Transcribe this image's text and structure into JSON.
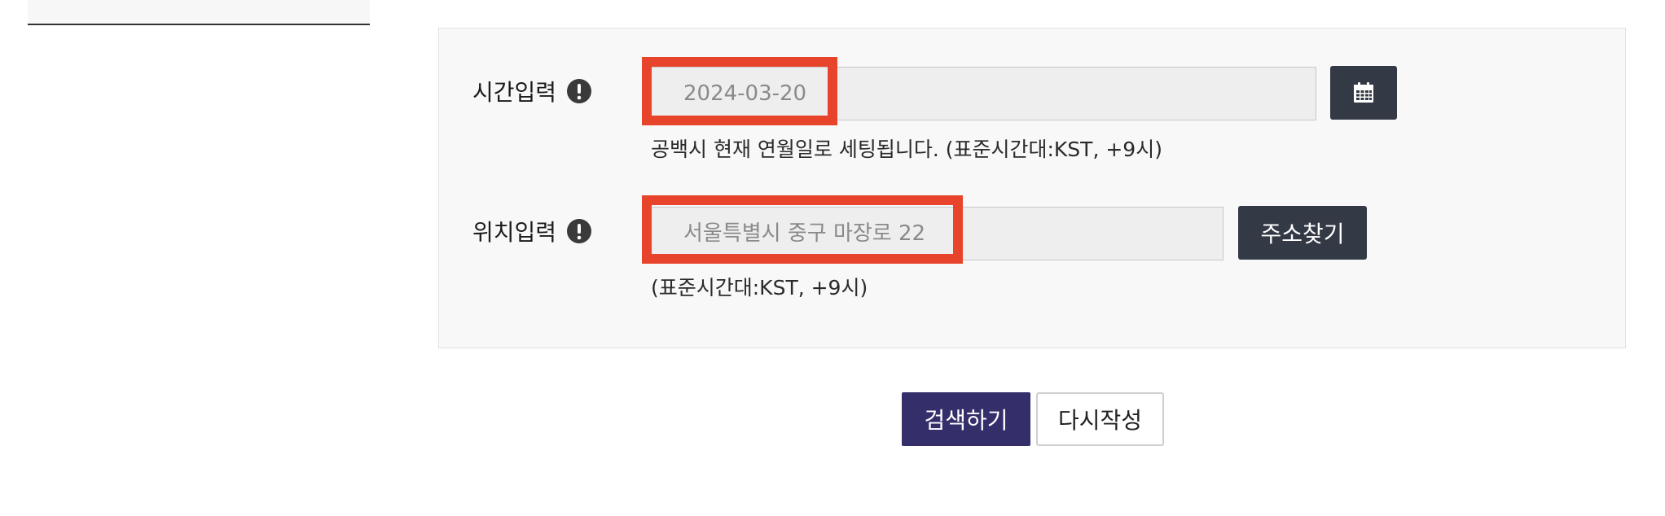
{
  "form": {
    "time": {
      "label": "시간입력",
      "input_placeholder": "2024-03-20",
      "input_value": "",
      "helper": "공백시 현재 연월일로 세팅됩니다. (표준시간대:KST, +9시)"
    },
    "location": {
      "label": "위치입력",
      "input_placeholder": "서울특별시 중구 마장로 22",
      "input_value": "",
      "helper": "(표준시간대:KST, +9시)",
      "find_address_label": "주소찾기"
    }
  },
  "actions": {
    "search_label": "검색하기",
    "reset_label": "다시작성"
  },
  "icons": {
    "info": "info-icon",
    "calendar": "calendar-icon"
  },
  "colors": {
    "highlight": "#e8442b",
    "dark_button": "#343a45",
    "primary_button": "#342f6b",
    "panel_bg": "#f8f8f8"
  }
}
